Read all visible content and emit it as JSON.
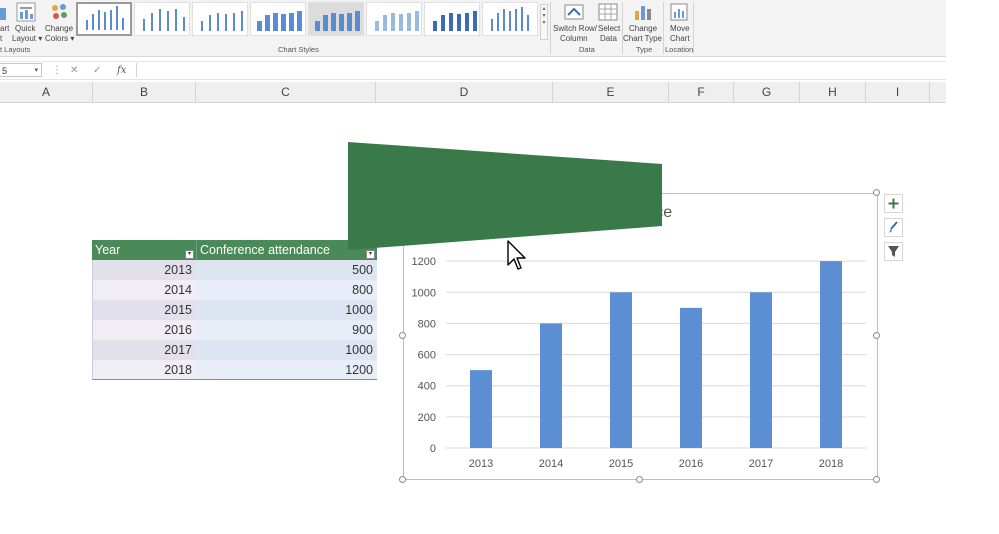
{
  "ribbon": {
    "quick_layout": {
      "line1": "Quick",
      "line2": "Layout"
    },
    "add_chart_element_partial": {
      "line1": "art",
      "line2": "t"
    },
    "change_colors": {
      "line1": "Change",
      "line2": "Colors"
    },
    "chart_layouts_label": "t Layouts",
    "chart_styles_label": "Chart Styles",
    "switch_row_column": {
      "line1": "Switch Row/",
      "line2": "Column"
    },
    "select_data": {
      "line1": "Select",
      "line2": "Data"
    },
    "data_group_label": "Data",
    "change_chart_type": {
      "line1": "Change",
      "line2": "Chart Type"
    },
    "type_group_label": "Type",
    "move_chart": {
      "line1": "Move",
      "line2": "Chart"
    },
    "location_group_label": "Location"
  },
  "formula_bar": {
    "name_box": "5",
    "cancel": "✕",
    "enter": "✓",
    "fx": "fx",
    "value": ""
  },
  "columns": [
    "A",
    "B",
    "C",
    "D",
    "E",
    "F",
    "G",
    "H",
    "I"
  ],
  "table": {
    "headers": [
      "Year",
      "Conference attendance"
    ],
    "rows": [
      [
        "2013",
        "500"
      ],
      [
        "2014",
        "800"
      ],
      [
        "2015",
        "1000"
      ],
      [
        "2016",
        "900"
      ],
      [
        "2017",
        "1000"
      ],
      [
        "2018",
        "1200"
      ]
    ]
  },
  "chart_elements": {
    "add_icon": "plus-icon",
    "style_icon": "brush-icon",
    "filter_icon": "filter-icon"
  },
  "colors": {
    "bar": "#5b8ed2",
    "table_header": "#4a8a58",
    "banner": "#3a7a4a"
  },
  "chart_data": {
    "type": "bar",
    "title": "endance",
    "categories": [
      "2013",
      "2014",
      "2015",
      "2016",
      "2017",
      "2018"
    ],
    "values": [
      500,
      800,
      1000,
      900,
      1000,
      1200
    ],
    "yticks": [
      0,
      200,
      400,
      600,
      800,
      1000,
      1200
    ],
    "ylim": [
      0,
      1400
    ],
    "grid": true,
    "xlabel": "",
    "ylabel": ""
  }
}
